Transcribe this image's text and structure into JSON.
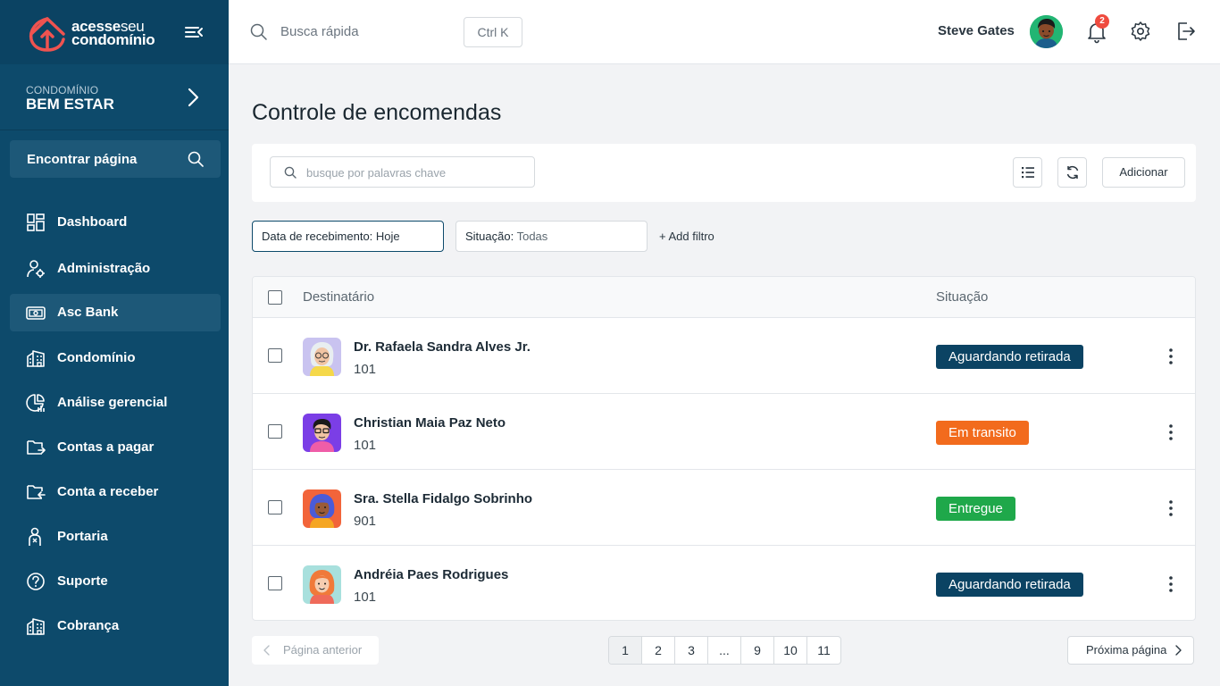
{
  "brand": {
    "line1_bold": "acesse",
    "line1_thin": "seu",
    "line2": "condomínio"
  },
  "condo": {
    "label": "CONDOMÍNIO",
    "name": "BEM ESTAR"
  },
  "sidebar": {
    "find_page": "Encontrar página",
    "items": [
      {
        "label": "Dashboard",
        "icon": "dashboard-icon"
      },
      {
        "label": "Administração",
        "icon": "admin-icon"
      },
      {
        "label": "Asc Bank",
        "icon": "bank-icon",
        "active": true
      },
      {
        "label": "Condomínio",
        "icon": "building-icon"
      },
      {
        "label": "Análise gerencial",
        "icon": "analytics-icon"
      },
      {
        "label": "Contas a pagar",
        "icon": "payable-icon"
      },
      {
        "label": "Conta a receber",
        "icon": "receivable-icon"
      },
      {
        "label": "Portaria",
        "icon": "doorman-icon"
      },
      {
        "label": "Suporte",
        "icon": "support-icon"
      },
      {
        "label": "Cobrança",
        "icon": "billing-icon"
      }
    ]
  },
  "topbar": {
    "quick_search": "Busca rápida",
    "shortcut": "Ctrl K",
    "user_name": "Steve Gates",
    "notifications": "2"
  },
  "main": {
    "title": "Controle de encomendas",
    "search_placeholder": "busque por palavras chave",
    "add_button": "Adicionar",
    "filters": [
      {
        "label": "Data de recebimento:",
        "value": "Hoje"
      },
      {
        "label": "Situação:",
        "value": "Todas"
      }
    ],
    "add_filter": "+ Add filtro"
  },
  "table": {
    "headers": {
      "recipient": "Destinatário",
      "status": "Situação"
    },
    "rows": [
      {
        "name": "Dr. Rafaela Sandra Alves Jr.",
        "unit": "101",
        "status": "Aguardando retirada",
        "status_color": "#0b4363"
      },
      {
        "name": "Christian Maia Paz Neto",
        "unit": "101",
        "status": "Em transito",
        "status_color": "#f26b1d"
      },
      {
        "name": "Sra. Stella Fidalgo Sobrinho",
        "unit": "901",
        "status": "Entregue",
        "status_color": "#1fa84a"
      },
      {
        "name": "Andréia Paes Rodrigues",
        "unit": "101",
        "status": "Aguardando retirada",
        "status_color": "#0b4363"
      }
    ]
  },
  "pagination": {
    "prev": "Página anterior",
    "next": "Próxima página",
    "pages": [
      "1",
      "2",
      "3",
      "...",
      "9",
      "10",
      "11"
    ],
    "current": "1"
  }
}
